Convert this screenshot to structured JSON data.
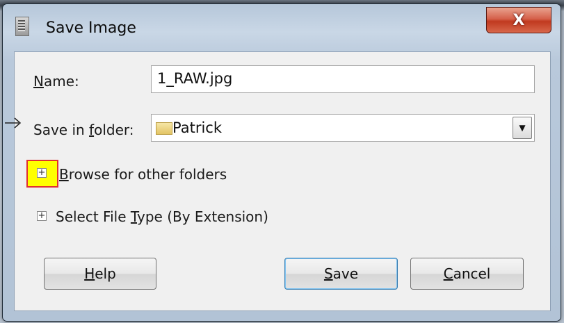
{
  "window": {
    "title": "Save Image",
    "close_glyph": "X"
  },
  "form": {
    "name_label_pre": "",
    "name_label_u": "N",
    "name_label_post": "ame:",
    "name_value": "1_RAW.jpg",
    "folder_label_pre": "Save in ",
    "folder_label_u": "f",
    "folder_label_post": "older:",
    "folder_value": "Patrick",
    "folder_arrow": "▼"
  },
  "expanders": {
    "browse_u": "B",
    "browse_post": "rowse for other folders",
    "filetype_pre": "Select File ",
    "filetype_u": "T",
    "filetype_post": "ype (By Extension)",
    "glyph": "+"
  },
  "buttons": {
    "help_u": "H",
    "help_post": "elp",
    "save_u": "S",
    "save_post": "ave",
    "cancel_u": "C",
    "cancel_post": "ancel"
  },
  "colors": {
    "highlight": "#ffff00",
    "highlight_border": "#e03030",
    "close_button": "#c7432a"
  },
  "icons": [
    "app-icon",
    "close-icon",
    "folder-icon",
    "dropdown-arrow-icon",
    "expander-plus-icon",
    "arrow-pointer-icon"
  ]
}
